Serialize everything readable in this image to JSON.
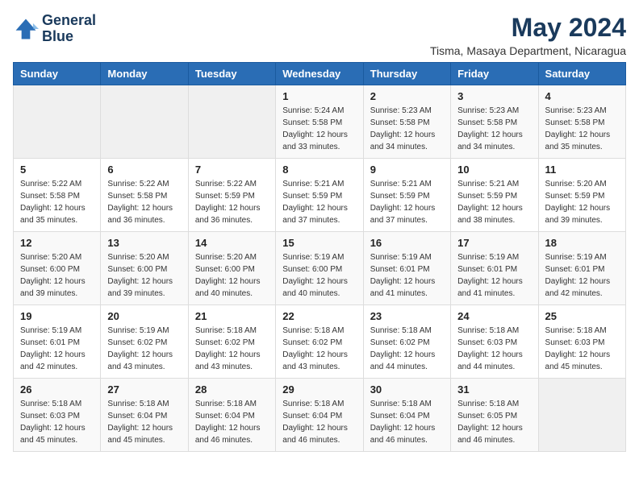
{
  "header": {
    "logo_line1": "General",
    "logo_line2": "Blue",
    "month_year": "May 2024",
    "location": "Tisma, Masaya Department, Nicaragua"
  },
  "weekdays": [
    "Sunday",
    "Monday",
    "Tuesday",
    "Wednesday",
    "Thursday",
    "Friday",
    "Saturday"
  ],
  "weeks": [
    [
      {
        "day": "",
        "sunrise": "",
        "sunset": "",
        "daylight": ""
      },
      {
        "day": "",
        "sunrise": "",
        "sunset": "",
        "daylight": ""
      },
      {
        "day": "",
        "sunrise": "",
        "sunset": "",
        "daylight": ""
      },
      {
        "day": "1",
        "sunrise": "Sunrise: 5:24 AM",
        "sunset": "Sunset: 5:58 PM",
        "daylight": "Daylight: 12 hours and 33 minutes."
      },
      {
        "day": "2",
        "sunrise": "Sunrise: 5:23 AM",
        "sunset": "Sunset: 5:58 PM",
        "daylight": "Daylight: 12 hours and 34 minutes."
      },
      {
        "day": "3",
        "sunrise": "Sunrise: 5:23 AM",
        "sunset": "Sunset: 5:58 PM",
        "daylight": "Daylight: 12 hours and 34 minutes."
      },
      {
        "day": "4",
        "sunrise": "Sunrise: 5:23 AM",
        "sunset": "Sunset: 5:58 PM",
        "daylight": "Daylight: 12 hours and 35 minutes."
      }
    ],
    [
      {
        "day": "5",
        "sunrise": "Sunrise: 5:22 AM",
        "sunset": "Sunset: 5:58 PM",
        "daylight": "Daylight: 12 hours and 35 minutes."
      },
      {
        "day": "6",
        "sunrise": "Sunrise: 5:22 AM",
        "sunset": "Sunset: 5:58 PM",
        "daylight": "Daylight: 12 hours and 36 minutes."
      },
      {
        "day": "7",
        "sunrise": "Sunrise: 5:22 AM",
        "sunset": "Sunset: 5:59 PM",
        "daylight": "Daylight: 12 hours and 36 minutes."
      },
      {
        "day": "8",
        "sunrise": "Sunrise: 5:21 AM",
        "sunset": "Sunset: 5:59 PM",
        "daylight": "Daylight: 12 hours and 37 minutes."
      },
      {
        "day": "9",
        "sunrise": "Sunrise: 5:21 AM",
        "sunset": "Sunset: 5:59 PM",
        "daylight": "Daylight: 12 hours and 37 minutes."
      },
      {
        "day": "10",
        "sunrise": "Sunrise: 5:21 AM",
        "sunset": "Sunset: 5:59 PM",
        "daylight": "Daylight: 12 hours and 38 minutes."
      },
      {
        "day": "11",
        "sunrise": "Sunrise: 5:20 AM",
        "sunset": "Sunset: 5:59 PM",
        "daylight": "Daylight: 12 hours and 39 minutes."
      }
    ],
    [
      {
        "day": "12",
        "sunrise": "Sunrise: 5:20 AM",
        "sunset": "Sunset: 6:00 PM",
        "daylight": "Daylight: 12 hours and 39 minutes."
      },
      {
        "day": "13",
        "sunrise": "Sunrise: 5:20 AM",
        "sunset": "Sunset: 6:00 PM",
        "daylight": "Daylight: 12 hours and 39 minutes."
      },
      {
        "day": "14",
        "sunrise": "Sunrise: 5:20 AM",
        "sunset": "Sunset: 6:00 PM",
        "daylight": "Daylight: 12 hours and 40 minutes."
      },
      {
        "day": "15",
        "sunrise": "Sunrise: 5:19 AM",
        "sunset": "Sunset: 6:00 PM",
        "daylight": "Daylight: 12 hours and 40 minutes."
      },
      {
        "day": "16",
        "sunrise": "Sunrise: 5:19 AM",
        "sunset": "Sunset: 6:01 PM",
        "daylight": "Daylight: 12 hours and 41 minutes."
      },
      {
        "day": "17",
        "sunrise": "Sunrise: 5:19 AM",
        "sunset": "Sunset: 6:01 PM",
        "daylight": "Daylight: 12 hours and 41 minutes."
      },
      {
        "day": "18",
        "sunrise": "Sunrise: 5:19 AM",
        "sunset": "Sunset: 6:01 PM",
        "daylight": "Daylight: 12 hours and 42 minutes."
      }
    ],
    [
      {
        "day": "19",
        "sunrise": "Sunrise: 5:19 AM",
        "sunset": "Sunset: 6:01 PM",
        "daylight": "Daylight: 12 hours and 42 minutes."
      },
      {
        "day": "20",
        "sunrise": "Sunrise: 5:19 AM",
        "sunset": "Sunset: 6:02 PM",
        "daylight": "Daylight: 12 hours and 43 minutes."
      },
      {
        "day": "21",
        "sunrise": "Sunrise: 5:18 AM",
        "sunset": "Sunset: 6:02 PM",
        "daylight": "Daylight: 12 hours and 43 minutes."
      },
      {
        "day": "22",
        "sunrise": "Sunrise: 5:18 AM",
        "sunset": "Sunset: 6:02 PM",
        "daylight": "Daylight: 12 hours and 43 minutes."
      },
      {
        "day": "23",
        "sunrise": "Sunrise: 5:18 AM",
        "sunset": "Sunset: 6:02 PM",
        "daylight": "Daylight: 12 hours and 44 minutes."
      },
      {
        "day": "24",
        "sunrise": "Sunrise: 5:18 AM",
        "sunset": "Sunset: 6:03 PM",
        "daylight": "Daylight: 12 hours and 44 minutes."
      },
      {
        "day": "25",
        "sunrise": "Sunrise: 5:18 AM",
        "sunset": "Sunset: 6:03 PM",
        "daylight": "Daylight: 12 hours and 45 minutes."
      }
    ],
    [
      {
        "day": "26",
        "sunrise": "Sunrise: 5:18 AM",
        "sunset": "Sunset: 6:03 PM",
        "daylight": "Daylight: 12 hours and 45 minutes."
      },
      {
        "day": "27",
        "sunrise": "Sunrise: 5:18 AM",
        "sunset": "Sunset: 6:04 PM",
        "daylight": "Daylight: 12 hours and 45 minutes."
      },
      {
        "day": "28",
        "sunrise": "Sunrise: 5:18 AM",
        "sunset": "Sunset: 6:04 PM",
        "daylight": "Daylight: 12 hours and 46 minutes."
      },
      {
        "day": "29",
        "sunrise": "Sunrise: 5:18 AM",
        "sunset": "Sunset: 6:04 PM",
        "daylight": "Daylight: 12 hours and 46 minutes."
      },
      {
        "day": "30",
        "sunrise": "Sunrise: 5:18 AM",
        "sunset": "Sunset: 6:04 PM",
        "daylight": "Daylight: 12 hours and 46 minutes."
      },
      {
        "day": "31",
        "sunrise": "Sunrise: 5:18 AM",
        "sunset": "Sunset: 6:05 PM",
        "daylight": "Daylight: 12 hours and 46 minutes."
      },
      {
        "day": "",
        "sunrise": "",
        "sunset": "",
        "daylight": ""
      }
    ]
  ]
}
